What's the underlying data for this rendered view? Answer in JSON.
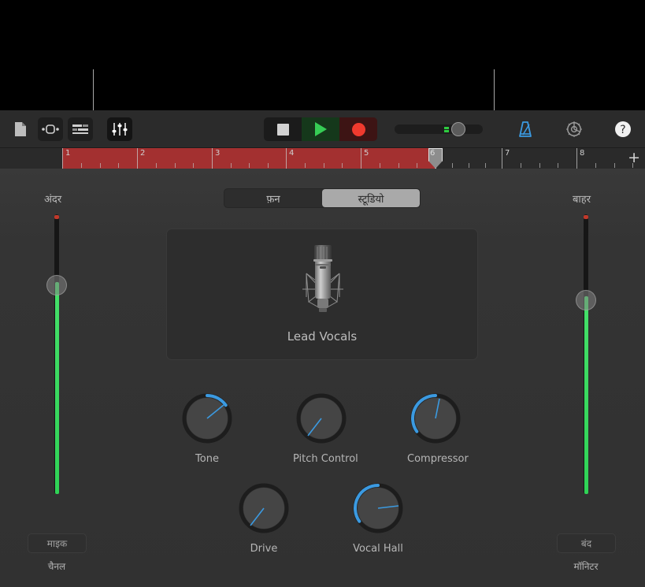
{
  "toolbar": {
    "left_icons": [
      {
        "name": "document-icon",
        "label": "Document"
      },
      {
        "name": "loop-browser-icon",
        "label": "Loop Browser"
      },
      {
        "name": "track-list-icon",
        "label": "Track List"
      },
      {
        "name": "mixer-icon",
        "label": "Mixer"
      }
    ],
    "transport": {
      "stop_label": "Stop",
      "play_label": "Play",
      "record_label": "Record"
    },
    "volume": {
      "name": "master-volume-slider",
      "value": "64"
    },
    "right_icons": [
      {
        "name": "metronome-icon",
        "label": "Metronome"
      },
      {
        "name": "gear-icon",
        "label": "Settings"
      },
      {
        "name": "help-icon",
        "label": "Help",
        "glyph": "?"
      }
    ]
  },
  "ruler": {
    "bars": [
      "1",
      "2",
      "3",
      "4",
      "5",
      "6",
      "7",
      "8"
    ],
    "playhead_bar": "6",
    "cycle_start_bar": "1",
    "cycle_end_bar": "6",
    "add_button_glyph": "+",
    "cycle_color": "#a33030"
  },
  "tabs": {
    "items": [
      {
        "label": "फ़न",
        "name": "tab-fun",
        "selected": false
      },
      {
        "label": "स्टूडियो",
        "name": "tab-studio",
        "selected": true
      }
    ]
  },
  "left_channel": {
    "title": "अंदर",
    "icon_name": "microphone-icon",
    "button_label": "माइक",
    "caption": "चैनल"
  },
  "right_channel": {
    "title": "बाहर",
    "button_label": "बंद",
    "caption": "मॉनिटर"
  },
  "instrument": {
    "name": "Lead Vocals",
    "icon_name": "condenser-microphone-icon"
  },
  "knobs": [
    {
      "label": "Tone",
      "name": "knob-tone",
      "arc_start": 0,
      "arc_sweep": 55,
      "pointer": 55,
      "arc_color": "#3b9ae1"
    },
    {
      "label": "Pitch Control",
      "name": "knob-pitch-control",
      "arc_start": 0,
      "arc_sweep": 0,
      "pointer": -145,
      "arc_color": "#3b9ae1"
    },
    {
      "label": "Compressor",
      "name": "knob-compressor",
      "arc_start": -125,
      "arc_sweep": 125,
      "pointer": 10,
      "arc_color": "#3b9ae1"
    },
    {
      "label": "Drive",
      "name": "knob-drive",
      "arc_start": 0,
      "arc_sweep": 0,
      "pointer": -145,
      "arc_color": "#3b9ae1"
    },
    {
      "label": "Vocal Hall",
      "name": "knob-vocal-hall",
      "arc_start": -125,
      "arc_sweep": 55,
      "pointer": 75,
      "arc_color": "#3b9ae1"
    }
  ],
  "colors": {
    "accent_blue": "#3b9ae1",
    "record_red": "#f03a2e",
    "play_green": "#36cc55",
    "meter_green": "#2fd356",
    "background": "#343434"
  }
}
